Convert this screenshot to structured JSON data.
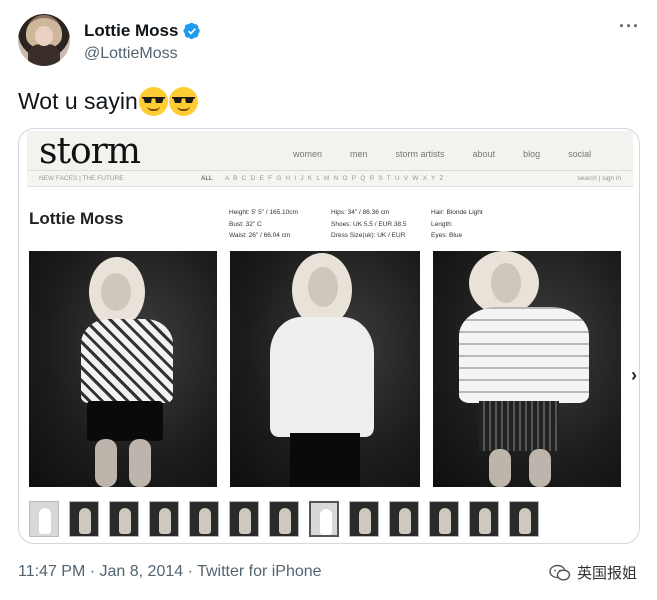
{
  "tweet": {
    "display_name": "Lottie Moss",
    "handle": "@LottieMoss",
    "text": "Wot u sayin",
    "emojis": [
      "smiling-face-with-sunglasses",
      "smiling-face-with-sunglasses"
    ],
    "meta": "11:47 PM · Jan 8, 2014 · Twitter for iPhone",
    "more": "···",
    "verified_color": "#1d9bf0"
  },
  "site": {
    "logo": "storm",
    "nav": [
      "women",
      "men",
      "storm artists",
      "about",
      "blog",
      "social"
    ],
    "sub_left": "NEW FACES | THE FUTURE",
    "sub_all": "ALL",
    "letters": "A B C D E F G H I J K L M N O P Q R S T U V W X Y Z",
    "sub_right": "search | sign in",
    "model_name": "Lottie Moss",
    "stats_col1": [
      "Height: 5' 5\" / 165.10cm",
      "Bust: 32\" C",
      "Waist: 26\" / 66.04 cm"
    ],
    "stats_col2": [
      "Hips: 34\" / 86.36 cm",
      "Shoes: UK 5.5 / EUR 38.5",
      "Dress Size(uk): UK / EUR"
    ],
    "stats_col3": [
      "Hair: Blonde Light",
      "Length:",
      "Eyes: Blue"
    ],
    "next": "›"
  },
  "watermark": "英国报姐"
}
